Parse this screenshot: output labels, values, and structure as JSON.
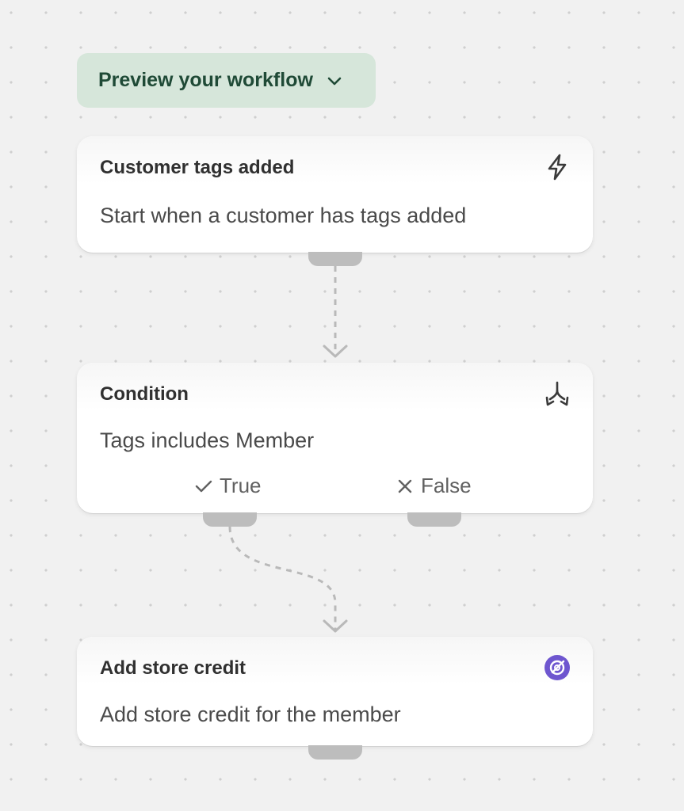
{
  "preview": {
    "label": "Preview your workflow"
  },
  "nodes": [
    {
      "id": "trigger",
      "title": "Customer tags added",
      "description": "Start when a customer has tags added",
      "icon": "lightning-icon"
    },
    {
      "id": "condition",
      "title": "Condition",
      "description": "Tags includes Member",
      "icon": "branch-split-icon",
      "branches": {
        "true_label": "True",
        "false_label": "False"
      }
    },
    {
      "id": "action",
      "title": "Add store credit",
      "description": "Add store credit for the member",
      "icon": "store-credit-icon"
    }
  ],
  "colors": {
    "preview_bg": "#d6e6da",
    "preview_text": "#1f4a36",
    "connector": "#bdbdbd",
    "action_icon_bg": "#6e56cf"
  }
}
